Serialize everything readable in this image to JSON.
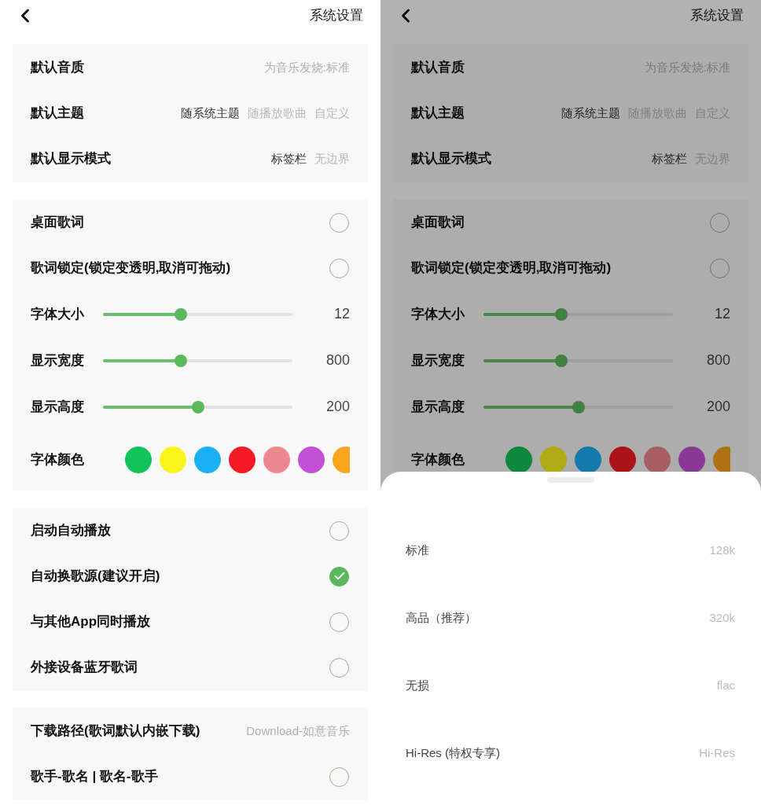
{
  "screens": [
    {
      "title": "系统设置",
      "sections": [
        {
          "rows": [
            {
              "kind": "value",
              "label": "默认音质",
              "value": "为音乐发烧:标准"
            },
            {
              "kind": "options",
              "label": "默认主题",
              "options": [
                {
                  "text": "随系统主题",
                  "selected": true
                },
                {
                  "text": "随播放歌曲",
                  "selected": false
                },
                {
                  "text": "自定义",
                  "selected": false
                }
              ]
            },
            {
              "kind": "options",
              "label": "默认显示模式",
              "options": [
                {
                  "text": "标签栏",
                  "selected": true
                },
                {
                  "text": "无边界",
                  "selected": false
                }
              ]
            }
          ]
        },
        {
          "rows": [
            {
              "kind": "toggle",
              "label": "桌面歌词",
              "checked": false
            },
            {
              "kind": "toggle",
              "label": "歌词锁定(锁定变透明,取消可拖动)",
              "checked": false
            },
            {
              "kind": "slider",
              "label": "字体大小",
              "level": 0.41,
              "reading": "12"
            },
            {
              "kind": "slider",
              "label": "显示宽度",
              "level": 0.41,
              "reading": "800"
            },
            {
              "kind": "slider",
              "label": "显示高度",
              "level": 0.5,
              "reading": "200"
            },
            {
              "kind": "colors",
              "label": "字体颜色",
              "colors": [
                {
                  "color": "#11c45a"
                },
                {
                  "color": "#fcf51c"
                },
                {
                  "color": "#1bb0f5"
                },
                {
                  "color": "#f51a24"
                },
                {
                  "color": "#ee8790"
                },
                {
                  "color": "#c351d6"
                },
                {
                  "color": "#faa51d"
                }
              ]
            }
          ]
        },
        {
          "rows": [
            {
              "kind": "toggle",
              "label": "启动自动播放",
              "checked": false
            },
            {
              "kind": "toggle",
              "label": "自动换歌源(建议开启)",
              "checked": true
            },
            {
              "kind": "toggle",
              "label": "与其他App同时播放",
              "checked": false
            },
            {
              "kind": "toggle",
              "label": "外接设备蓝牙歌词",
              "checked": false
            }
          ]
        },
        {
          "rows": [
            {
              "kind": "value",
              "label": "下载路径(歌词默认内嵌下载)",
              "value": "Download-如意音乐"
            },
            {
              "kind": "toggle",
              "label": "歌手-歌名 | 歌名-歌手",
              "checked": false
            }
          ]
        }
      ]
    },
    {
      "title": "系统设置",
      "dimmed": true,
      "sections": [
        {
          "rows": [
            {
              "kind": "value",
              "label": "默认音质",
              "value": "为音乐发烧:标准"
            },
            {
              "kind": "options",
              "label": "默认主题",
              "options": [
                {
                  "text": "随系统主题",
                  "selected": true
                },
                {
                  "text": "随播放歌曲",
                  "selected": false
                },
                {
                  "text": "自定义",
                  "selected": false
                }
              ]
            },
            {
              "kind": "options",
              "label": "默认显示模式",
              "options": [
                {
                  "text": "标签栏",
                  "selected": true
                },
                {
                  "text": "无边界",
                  "selected": false
                }
              ]
            }
          ]
        },
        {
          "rows": [
            {
              "kind": "toggle",
              "label": "桌面歌词",
              "checked": false
            },
            {
              "kind": "toggle",
              "label": "歌词锁定(锁定变透明,取消可拖动)",
              "checked": false
            },
            {
              "kind": "slider",
              "label": "字体大小",
              "level": 0.41,
              "reading": "12"
            },
            {
              "kind": "slider",
              "label": "显示宽度",
              "level": 0.41,
              "reading": "800"
            },
            {
              "kind": "slider",
              "label": "显示高度",
              "level": 0.5,
              "reading": "200"
            },
            {
              "kind": "colors",
              "label": "字体颜色",
              "colors": [
                {
                  "color": "#0c893f"
                },
                {
                  "color": "#b0ab14"
                },
                {
                  "color": "#137bab"
                },
                {
                  "color": "#ab1219"
                },
                {
                  "color": "#a75f65"
                },
                {
                  "color": "#883996"
                },
                {
                  "color": "#af7314"
                }
              ]
            }
          ]
        }
      ],
      "sheet": {
        "options": [
          {
            "label": "标准",
            "value": "128k"
          },
          {
            "label": "高品（推荐）",
            "value": "320k"
          },
          {
            "label": "无损",
            "value": "flac"
          },
          {
            "label": "Hi-Res (特权专享)",
            "value": "Hi-Res"
          }
        ]
      }
    }
  ]
}
